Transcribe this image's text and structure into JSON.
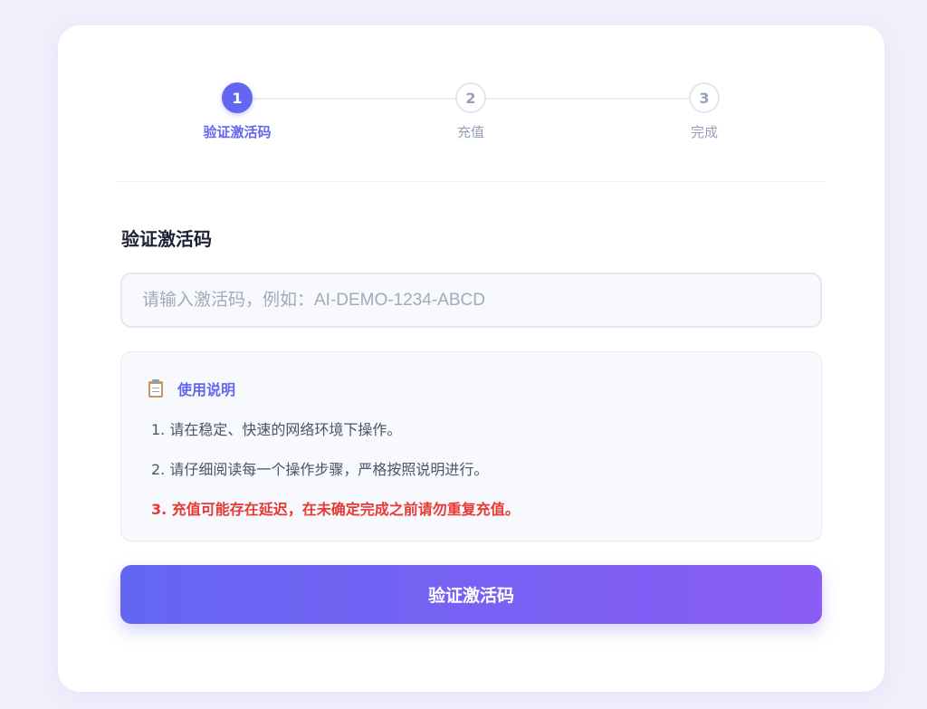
{
  "stepper": {
    "steps": [
      {
        "number": "1",
        "label": "验证激活码",
        "state": "active"
      },
      {
        "number": "2",
        "label": "充值",
        "state": "inactive"
      },
      {
        "number": "3",
        "label": "完成",
        "state": "inactive"
      }
    ]
  },
  "section": {
    "title": "验证激活码"
  },
  "code_input": {
    "value": "",
    "placeholder": "请输入激活码，例如：AI-DEMO-1234-ABCD"
  },
  "instructions": {
    "icon": "clipboard-icon",
    "title": "使用说明",
    "items": [
      "1. 请在稳定、快速的网络环境下操作。",
      "2. 请仔细阅读每一个操作步骤，严格按照说明进行。",
      "3. 充值可能存在延迟，在未确定完成之前请勿重复充值。"
    ]
  },
  "submit": {
    "label": "验证激活码"
  },
  "colors": {
    "accent": "#6366f1",
    "gradient_end": "#8b5cf6",
    "warning": "#e53935",
    "muted": "#94a0b8"
  }
}
